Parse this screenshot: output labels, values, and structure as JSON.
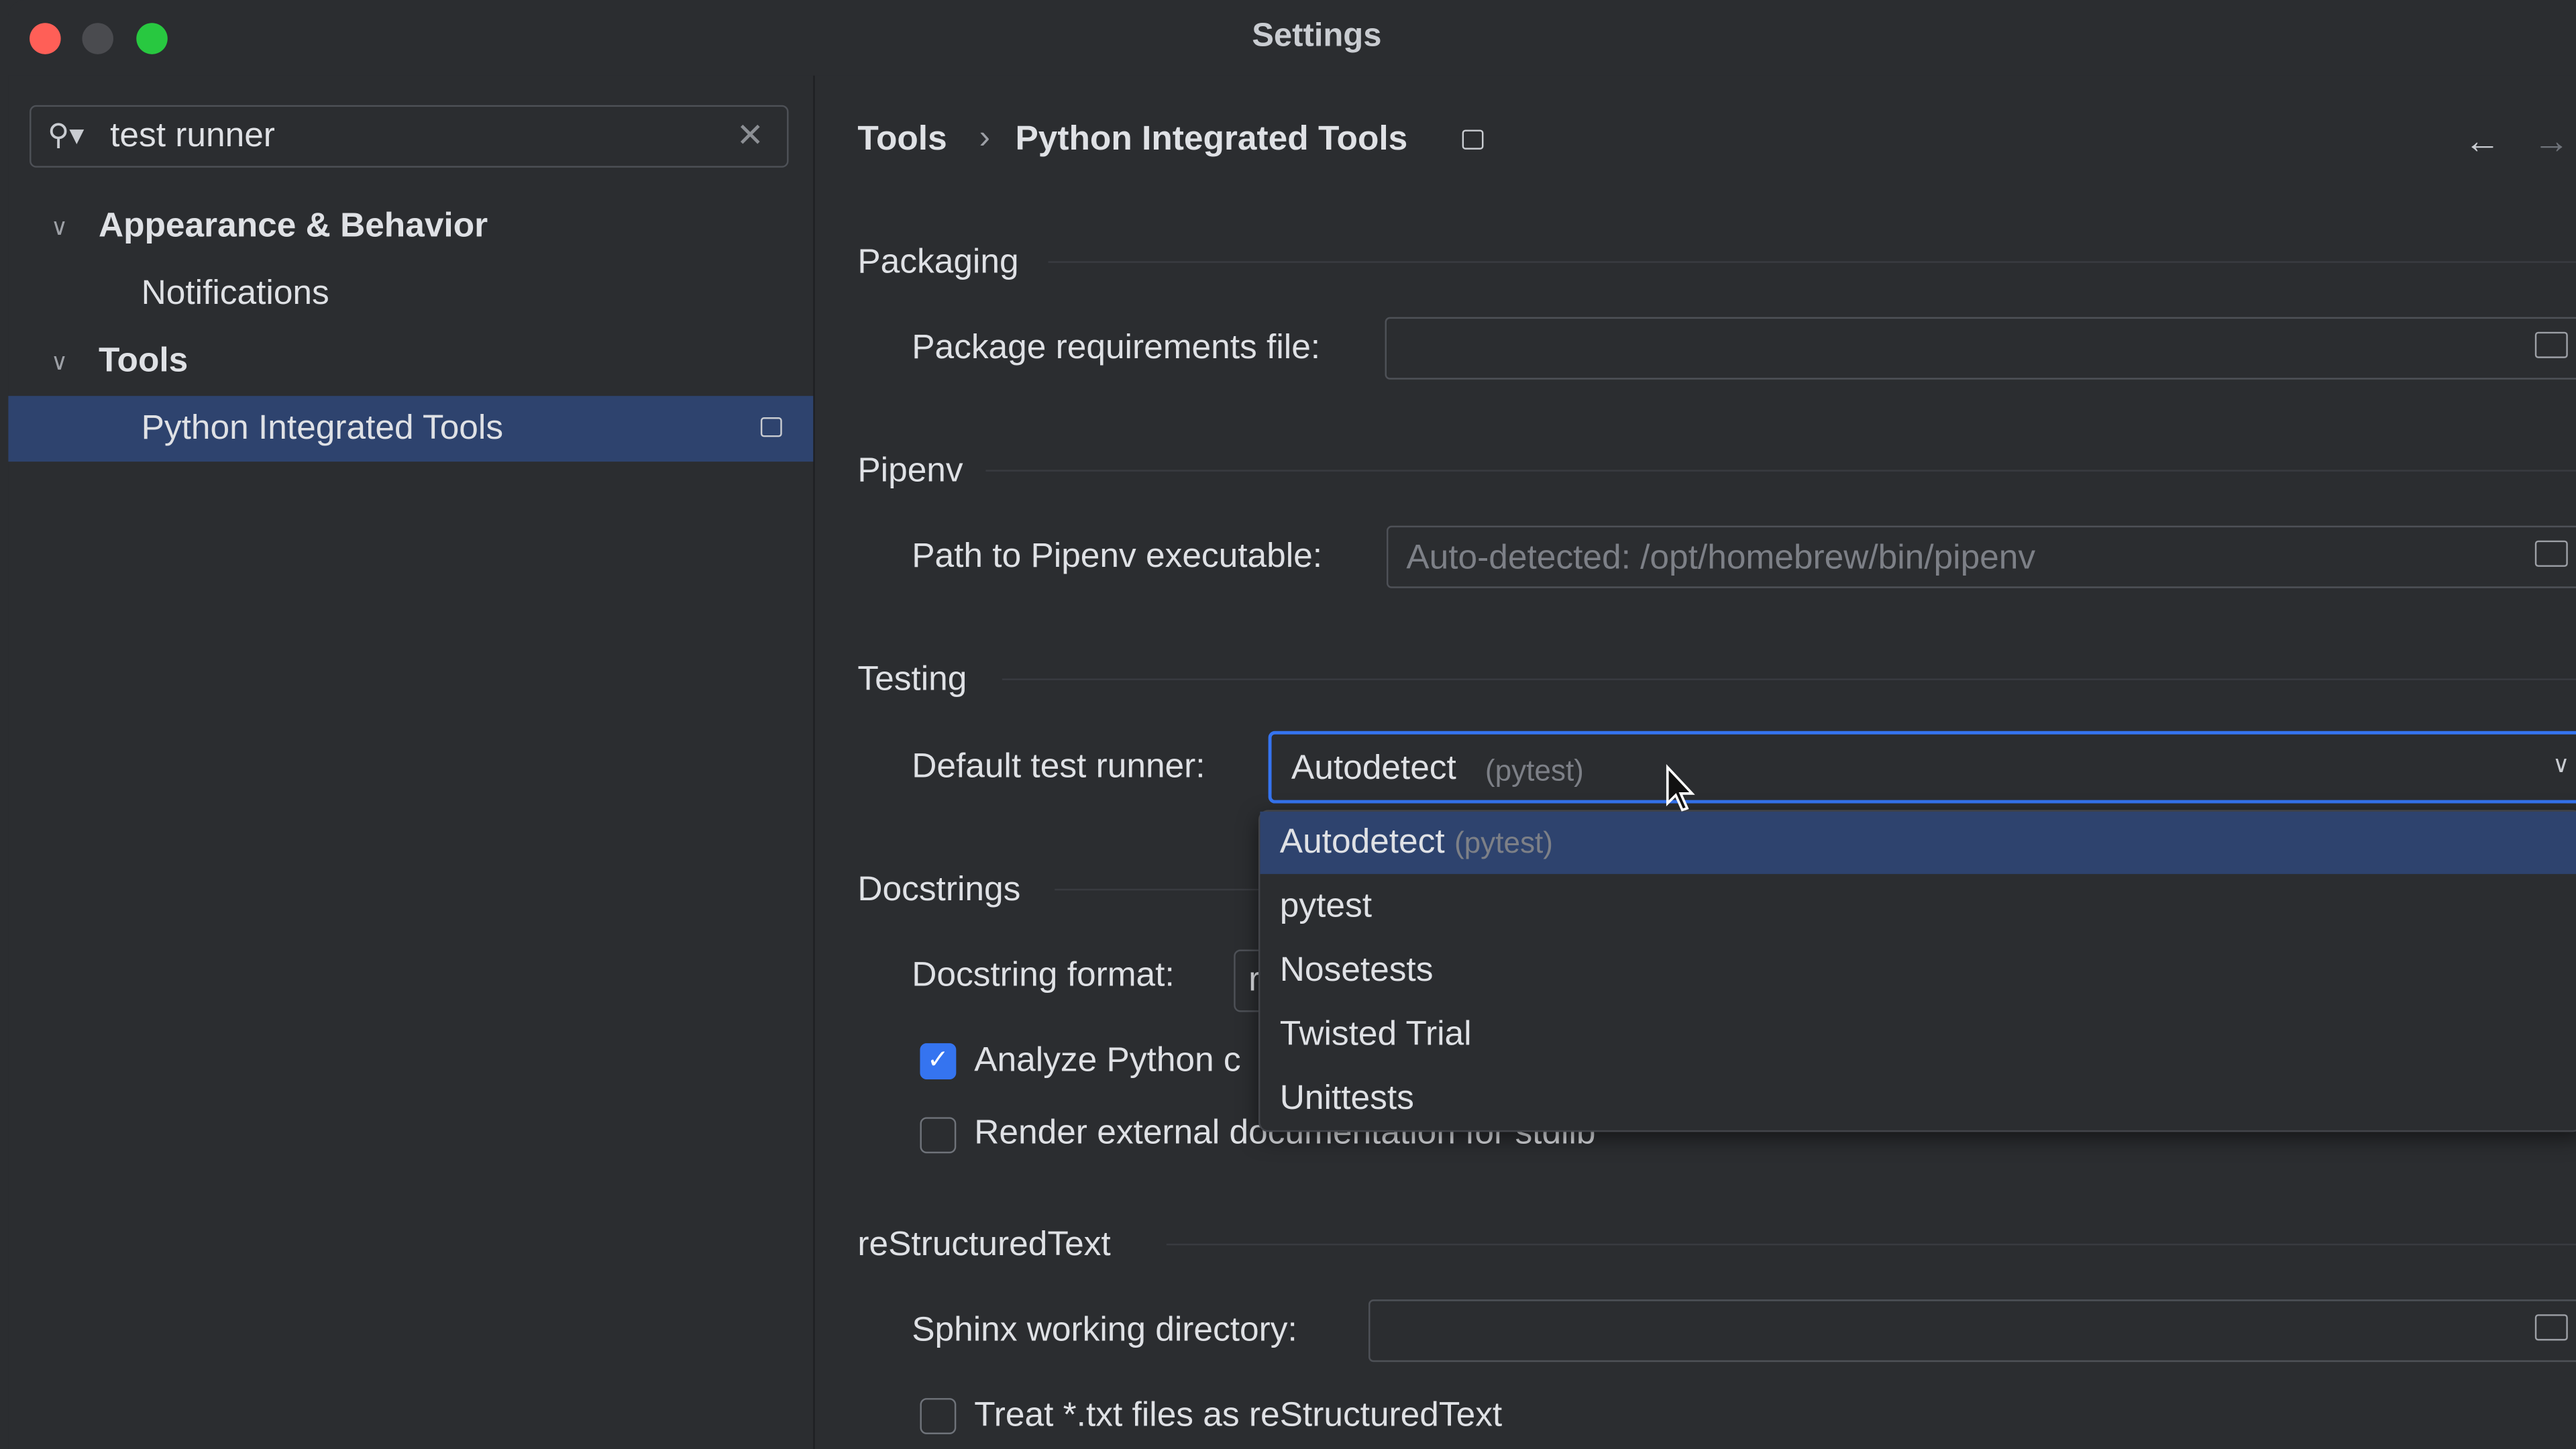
{
  "window": {
    "title": "Settings",
    "colors": {
      "close": "#ff5f57",
      "minimize": "#4a4b4f",
      "zoom": "#28c840",
      "accent": "#3574f0",
      "selection": "#2e436e"
    }
  },
  "sidebar": {
    "search": {
      "value": "test runner",
      "icon": "search-icon",
      "clear_icon": "close-icon"
    },
    "items": [
      {
        "label": "Appearance & Behavior",
        "expanded": true
      },
      {
        "label": "Notifications"
      },
      {
        "label": "Tools",
        "expanded": true
      },
      {
        "label": "Python Integrated Tools",
        "selected": true
      }
    ]
  },
  "header": {
    "breadcrumb": [
      "Tools",
      "Python Integrated Tools"
    ],
    "separator": "›",
    "back": "←",
    "forward": "→"
  },
  "sections": {
    "packaging": {
      "title": "Packaging",
      "label": "Package requirements file:",
      "value": ""
    },
    "pipenv": {
      "title": "Pipenv",
      "label": "Path to Pipenv executable:",
      "placeholder": "Auto-detected: /opt/homebrew/bin/pipenv"
    },
    "testing": {
      "title": "Testing",
      "label": "Default test runner:",
      "value": "Autodetect",
      "value_hint": "(pytest)"
    },
    "docstrings": {
      "title": "Docstrings",
      "label": "Docstring format:",
      "value": "r",
      "analyze": {
        "label": "Analyze Python c",
        "checked": true
      },
      "render": {
        "label": "Render external documentation for stdlib",
        "checked": false
      }
    },
    "rst": {
      "title": "reStructuredText",
      "label": "Sphinx working directory:",
      "value": "",
      "treat_txt": {
        "label": "Treat *.txt files as reStructuredText",
        "checked": false
      }
    }
  },
  "dropdown": {
    "options": [
      {
        "label": "Autodetect",
        "hint": "(pytest)",
        "highlighted": true
      },
      {
        "label": "pytest"
      },
      {
        "label": "Nosetests"
      },
      {
        "label": "Twisted Trial"
      },
      {
        "label": "Unittests"
      }
    ]
  }
}
